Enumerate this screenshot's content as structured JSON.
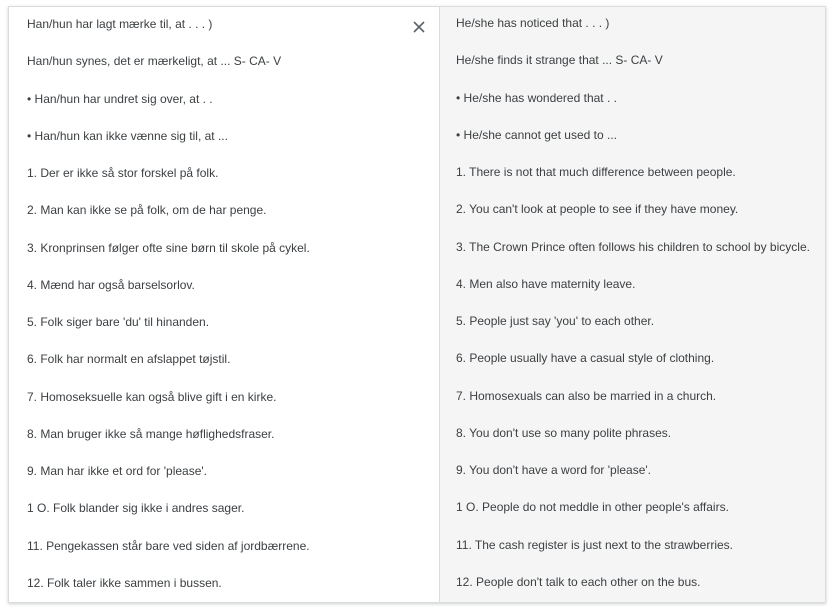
{
  "source": {
    "close_icon": "close-icon",
    "lines": [
      "Han/hun har lagt mærke til, at . . . )",
      "Han/hun synes, det er mærkeligt, at ... S- CA- V",
      "• Han/hun har undret sig over, at . .",
      "• Han/hun kan ikke vænne sig til, at ...",
      "1. Der er ikke så stor forskel på folk.",
      "2. Man kan ikke se på folk, om de har penge.",
      "3. Kronprinsen følger ofte sine børn til skole på cykel.",
      "4. Mænd har også barselsorlov.",
      "5. Folk siger bare 'du' til hinanden.",
      "6. Folk har normalt en afslappet tøjstil.",
      "7. Homoseksuelle kan også blive gift i en kirke.",
      "8. Man bruger ikke så mange høflighedsfraser.",
      "9. Man har ikke et ord for 'please'.",
      "1 O. Folk blander sig ikke i andres sager.",
      "11. Pengekassen står bare ved siden af jordbærrene.",
      "12. Folk taler ikke sammen i bussen."
    ]
  },
  "target": {
    "lines": [
      "He/she has noticed that . . . )",
      "He/she finds it strange that ... S- CA- V",
      "• He/she has wondered that . .",
      "• He/she cannot get used to ...",
      "1. There is not that much difference between people.",
      "2. You can't look at people to see if they have money.",
      "3. The Crown Prince often follows his children to school by bicycle.",
      "4. Men also have maternity leave.",
      "5. People just say 'you' to each other.",
      "6. People usually have a casual style of clothing.",
      "7. Homosexuals can also be married in a church.",
      "8. You don't use so many polite phrases.",
      "9. You don't have a word for 'please'.",
      "1 O. People do not meddle in other people's affairs.",
      "11. The cash register is just next to the strawberries.",
      "12. People don't talk to each other on the bus."
    ]
  }
}
